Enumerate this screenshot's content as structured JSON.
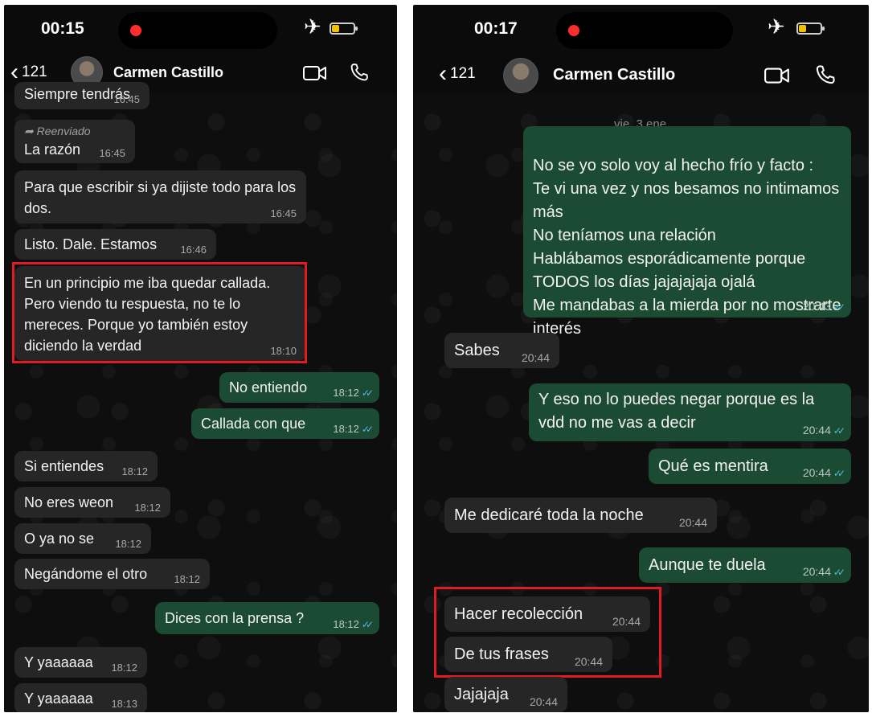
{
  "screens": [
    {
      "status_time": "00:15",
      "header": {
        "back_count": "121",
        "contact_name": "Carmen Castillo"
      },
      "messages": [
        {
          "dir": "in",
          "text": "Siempre tendrás",
          "time": "16:45",
          "forwarded_label": ""
        },
        {
          "dir": "in",
          "text": "La razón",
          "time": "16:45",
          "forwarded_label": "Reenviado"
        },
        {
          "dir": "in",
          "text": "Para que escribir si ya dijiste todo para los dos.",
          "time": "16:45",
          "forwarded_label": ""
        },
        {
          "dir": "in",
          "text": "Listo. Dale. Estamos",
          "time": "16:46",
          "forwarded_label": ""
        },
        {
          "dir": "in",
          "text": "En un principio me iba quedar callada. Pero viendo tu respuesta, no te lo mereces.  Porque yo también estoy diciendo la verdad",
          "time": "18:10",
          "forwarded_label": ""
        },
        {
          "dir": "out",
          "text": "No entiendo",
          "time": "18:12",
          "forwarded_label": ""
        },
        {
          "dir": "out",
          "text": "Callada con que",
          "time": "18:12",
          "forwarded_label": ""
        },
        {
          "dir": "in",
          "text": "Si entiendes",
          "time": "18:12",
          "forwarded_label": ""
        },
        {
          "dir": "in",
          "text": "No eres weon",
          "time": "18:12",
          "forwarded_label": ""
        },
        {
          "dir": "in",
          "text": "O ya no se",
          "time": "18:12",
          "forwarded_label": ""
        },
        {
          "dir": "in",
          "text": "Negándome el otro",
          "time": "18:12",
          "forwarded_label": ""
        },
        {
          "dir": "out",
          "text": "Dices con la prensa ?",
          "time": "18:12",
          "forwarded_label": ""
        },
        {
          "dir": "in",
          "text": "Y yaaaaaa",
          "time": "18:12",
          "forwarded_label": ""
        },
        {
          "dir": "in",
          "text": "Y yaaaaaa",
          "time": "18:13",
          "forwarded_label": ""
        }
      ]
    },
    {
      "status_time": "00:17",
      "header": {
        "back_count": "121",
        "contact_name": "Carmen Castillo"
      },
      "date_chip": "vie, 3 ene",
      "messages": [
        {
          "dir": "out",
          "text": "No se yo solo voy al hecho frío y facto :\nTe vi una vez y nos besamos no intimamos más\nNo teníamos una relación\nHablábamos esporádicamente porque TODOS los días jajajajaja ojalá\nMe mandabas a la mierda por no mostrarte interés",
          "time": "20:43"
        },
        {
          "dir": "in",
          "text": "Sabes",
          "time": "20:44"
        },
        {
          "dir": "out",
          "text": "Y eso no lo puedes negar porque es la vdd no me vas a decir",
          "time": "20:44"
        },
        {
          "dir": "out",
          "text": "Qué es mentira",
          "time": "20:44"
        },
        {
          "dir": "in",
          "text": "Me dedicaré toda la noche",
          "time": "20:44"
        },
        {
          "dir": "out",
          "text": "Aunque te duela",
          "time": "20:44"
        },
        {
          "dir": "in",
          "text": "Hacer recolección",
          "time": "20:44"
        },
        {
          "dir": "in",
          "text": "De tus frases",
          "time": "20:44"
        },
        {
          "dir": "in",
          "text": "Jajajaja",
          "time": "20:44"
        }
      ]
    }
  ],
  "colors": {
    "incoming_bubble": "#262626",
    "outgoing_bubble": "#1c4b34",
    "read_ticks": "#53bdeb",
    "highlight_box": "#e01b22",
    "recording_dot": "#ff2d2d",
    "battery_fill": "#f2c200"
  },
  "icons": [
    "chevron-left-icon",
    "video-call-icon",
    "voice-call-icon",
    "airplane-mode-icon",
    "battery-icon",
    "forward-arrow-icon",
    "read-receipt-icon"
  ]
}
